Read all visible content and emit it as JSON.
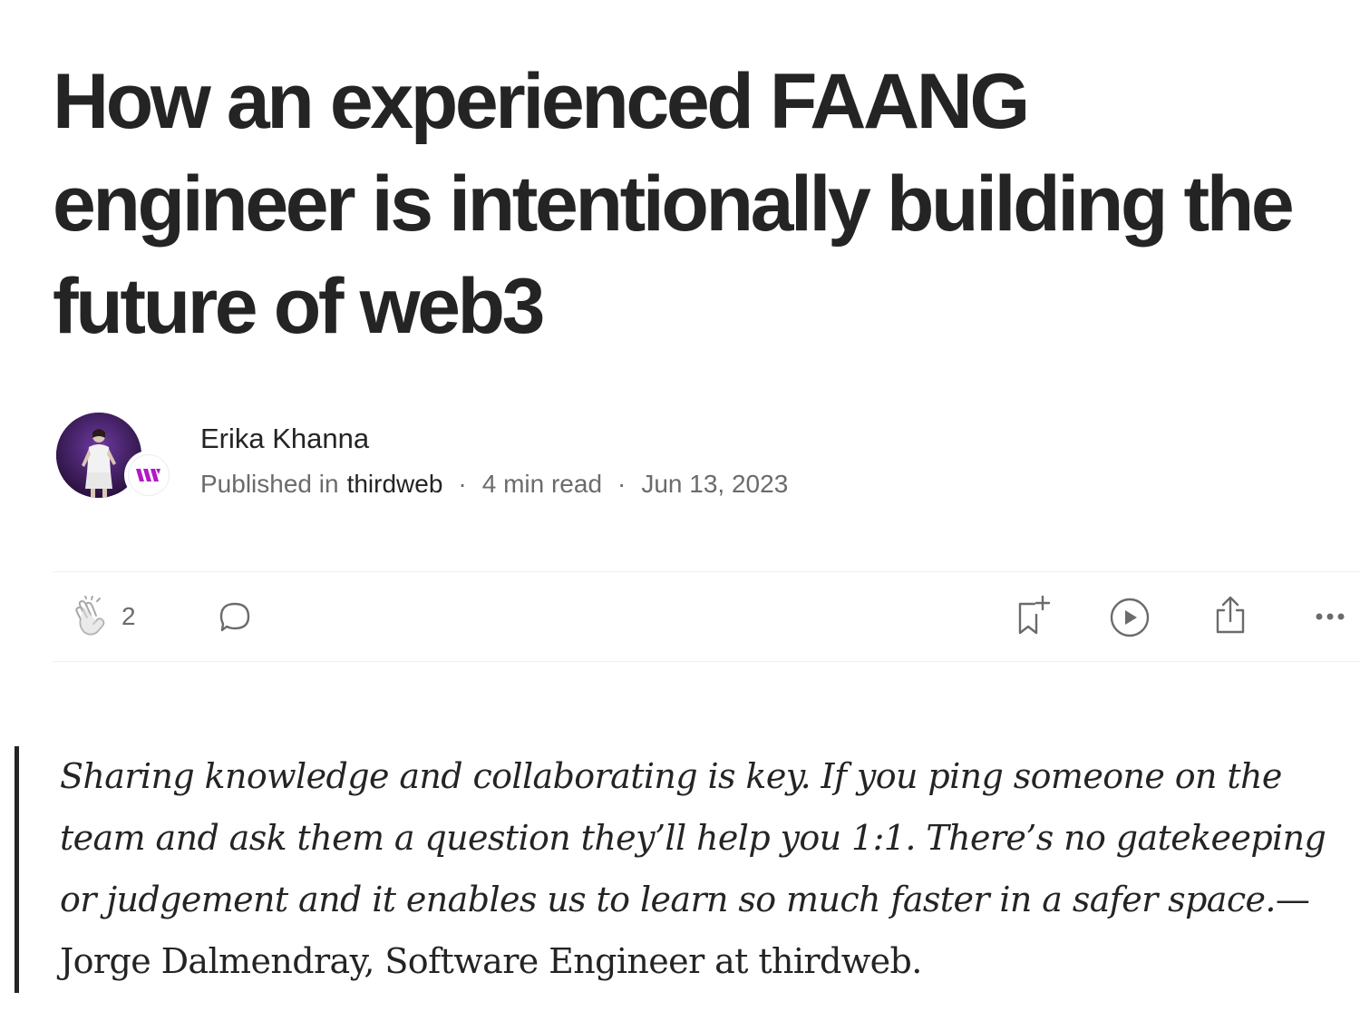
{
  "article": {
    "title": "How an experienced FAANG engineer is intentionally building the future of web3"
  },
  "author": {
    "name": "Erika Khanna",
    "published_prefix": "Published in",
    "publication": "thirdweb",
    "separator": "·",
    "read_time": "4 min read",
    "date": "Jun 13, 2023"
  },
  "actions": {
    "clap_count": "2",
    "icons": [
      "clap-icon",
      "comment-icon",
      "bookmark-add-icon",
      "play-icon",
      "share-icon",
      "more-icon"
    ]
  },
  "quote": {
    "text": "Sharing knowledge and collaborating is key. If you ping someone on the team and ask them a question they’ll help you 1:1. There’s no gatekeeping or judgement and it enables us to learn so much faster in a safer space.",
    "attribution": "—Jorge Dalmendray, Software Engineer at thirdweb."
  },
  "colors": {
    "text": "#242424",
    "muted": "#6b6b6b",
    "divider": "#f0f0f0",
    "brand_accent": "#b416c8"
  }
}
